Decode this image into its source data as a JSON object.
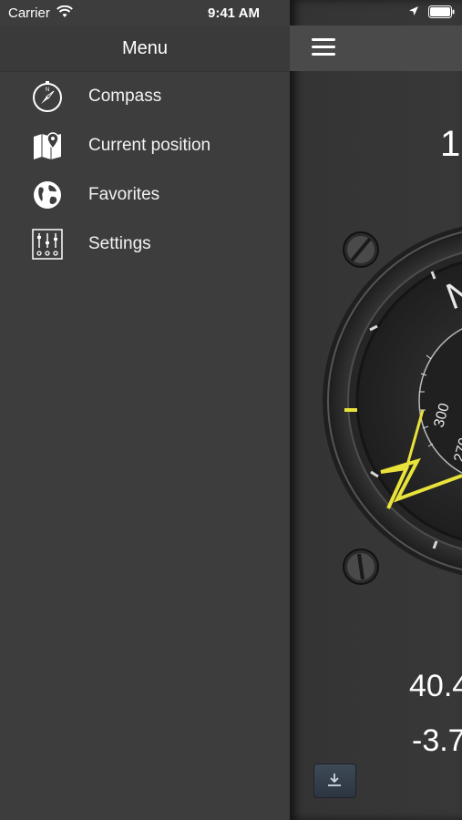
{
  "status": {
    "carrier": "Carrier",
    "time": "9:41 AM"
  },
  "menu": {
    "title": "Menu",
    "items": [
      {
        "label": "Compass",
        "icon": "compass-icon"
      },
      {
        "label": "Current position",
        "icon": "map-pin-icon"
      },
      {
        "label": "Favorites",
        "icon": "globe-icon"
      },
      {
        "label": "Settings",
        "icon": "sliders-icon"
      }
    ]
  },
  "main": {
    "heading_partial": "1",
    "latitude_partial": "40.4",
    "longitude_partial": "-3.7",
    "compass_labels": {
      "north": "N",
      "scale_300": "300",
      "scale_270": "270"
    }
  },
  "colors": {
    "needle": "#e8e23a",
    "sidebar_bg": "#3d3d3d",
    "nav_bg": "#4a4a4a"
  }
}
